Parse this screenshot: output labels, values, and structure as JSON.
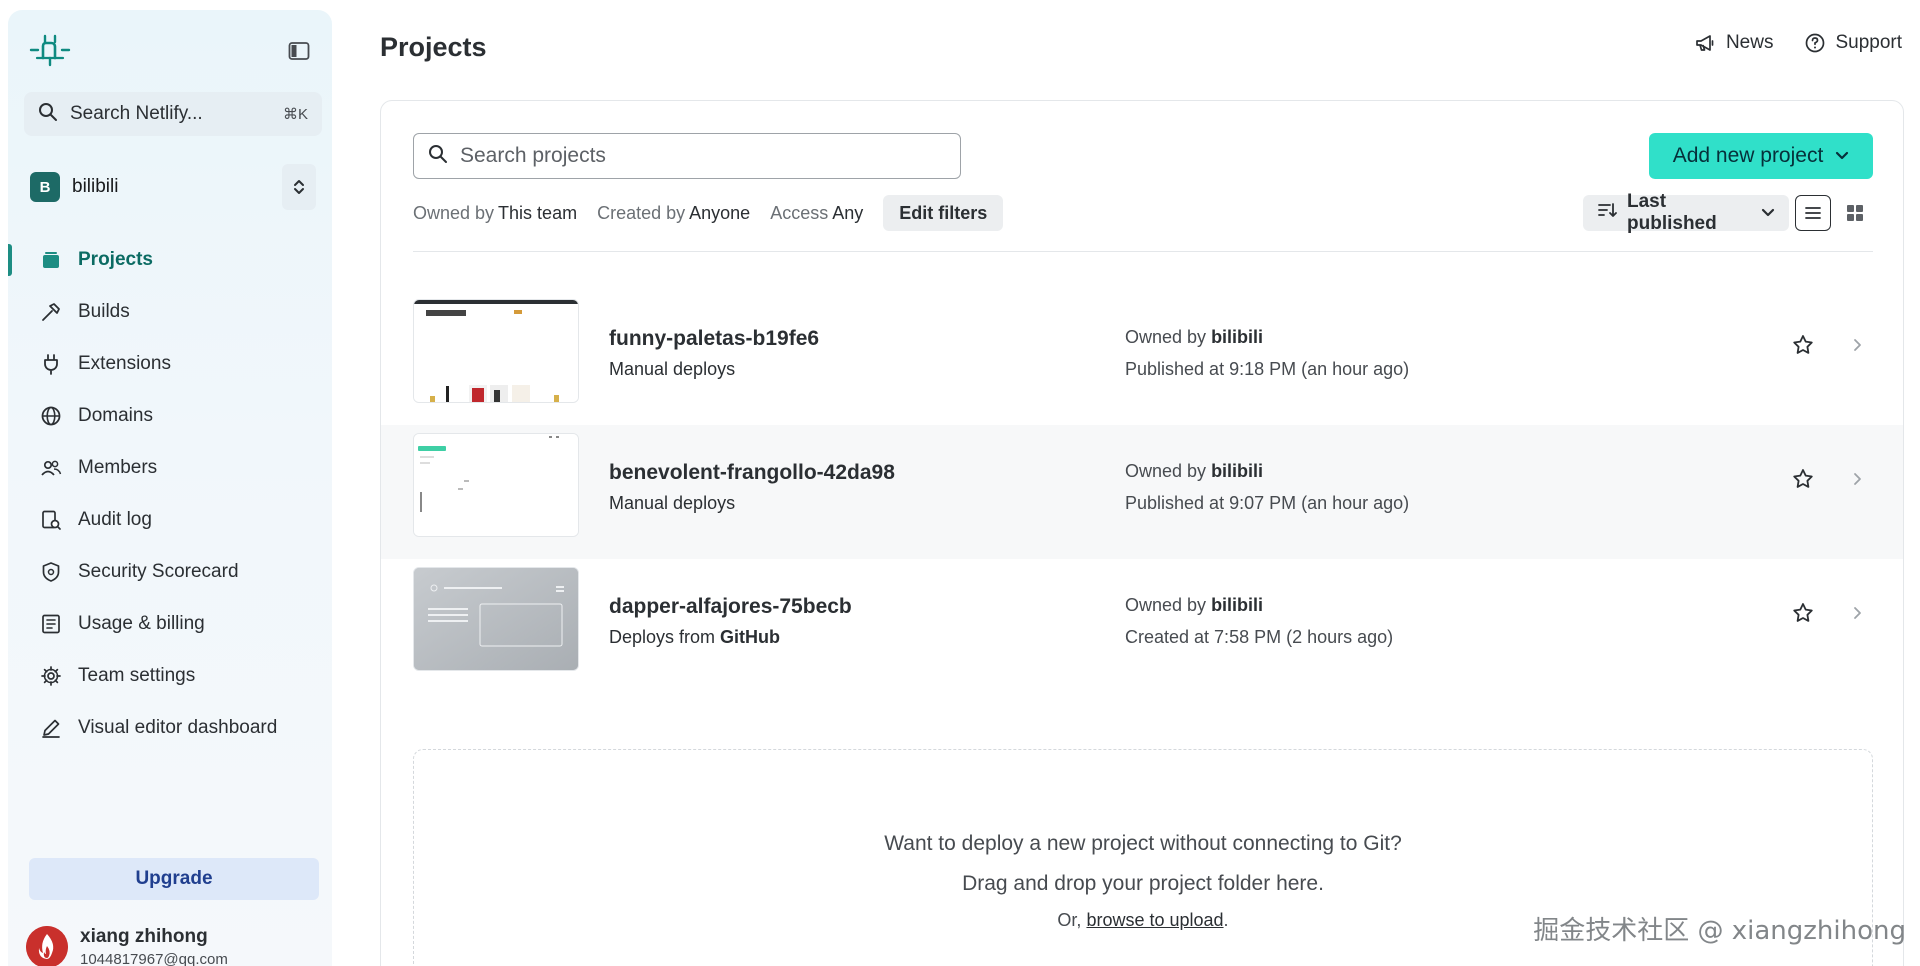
{
  "sidebar": {
    "search_label": "Search Netlify...",
    "search_shortcut": "⌘K",
    "team_initial": "B",
    "team_name": "bilibili",
    "items": [
      {
        "label": "Projects",
        "icon": "projects-icon",
        "active": true
      },
      {
        "label": "Builds",
        "icon": "hammer-icon"
      },
      {
        "label": "Extensions",
        "icon": "plug-icon"
      },
      {
        "label": "Domains",
        "icon": "globe-icon"
      },
      {
        "label": "Members",
        "icon": "users-icon"
      },
      {
        "label": "Audit log",
        "icon": "audit-log-icon"
      },
      {
        "label": "Security Scorecard",
        "icon": "shield-icon"
      },
      {
        "label": "Usage & billing",
        "icon": "receipt-icon"
      },
      {
        "label": "Team settings",
        "icon": "gear-icon"
      },
      {
        "label": "Visual editor dashboard",
        "icon": "pencil-icon"
      }
    ],
    "upgrade_label": "Upgrade",
    "user_name": "xiang zhihong",
    "user_email": "1044817967@qq.com"
  },
  "header": {
    "title": "Projects",
    "news_label": "News",
    "support_label": "Support"
  },
  "toolbar": {
    "search_placeholder": "Search projects",
    "add_label": "Add new project",
    "filters": [
      {
        "key": "Owned by",
        "value": "This team"
      },
      {
        "key": "Created by",
        "value": "Anyone"
      },
      {
        "key": "Access",
        "value": "Any"
      }
    ],
    "edit_filters_label": "Edit filters",
    "sort_label": "Last published"
  },
  "projects": [
    {
      "name": "funny-paletas-b19fe6",
      "deploy_prefix": "Manual deploys",
      "deploy_source": "",
      "owner_prefix": "Owned by",
      "owner": "bilibili",
      "published": "Published at 9:18 PM (an hour ago)"
    },
    {
      "name": "benevolent-frangollo-42da98",
      "deploy_prefix": "Manual deploys",
      "deploy_source": "",
      "owner_prefix": "Owned by",
      "owner": "bilibili",
      "published": "Published at 9:07 PM (an hour ago)"
    },
    {
      "name": "dapper-alfajores-75becb",
      "deploy_prefix": "Deploys from",
      "deploy_source": "GitHub",
      "owner_prefix": "Owned by",
      "owner": "bilibili",
      "published": "Created at 7:58 PM (2 hours ago)"
    }
  ],
  "dropzone": {
    "line1": "Want to deploy a new project without connecting to Git?",
    "line2": "Drag and drop your project folder here.",
    "line3_prefix": "Or,",
    "link": "browse to upload",
    "line3_suffix": "."
  },
  "watermark": "掘金技术社区 @ xiangzhihong",
  "colors": {
    "accent": "#30e0c9",
    "active_nav": "#0b6b63",
    "team_badge": "#1d6a66",
    "upgrade_bg": "#dde8f9"
  }
}
